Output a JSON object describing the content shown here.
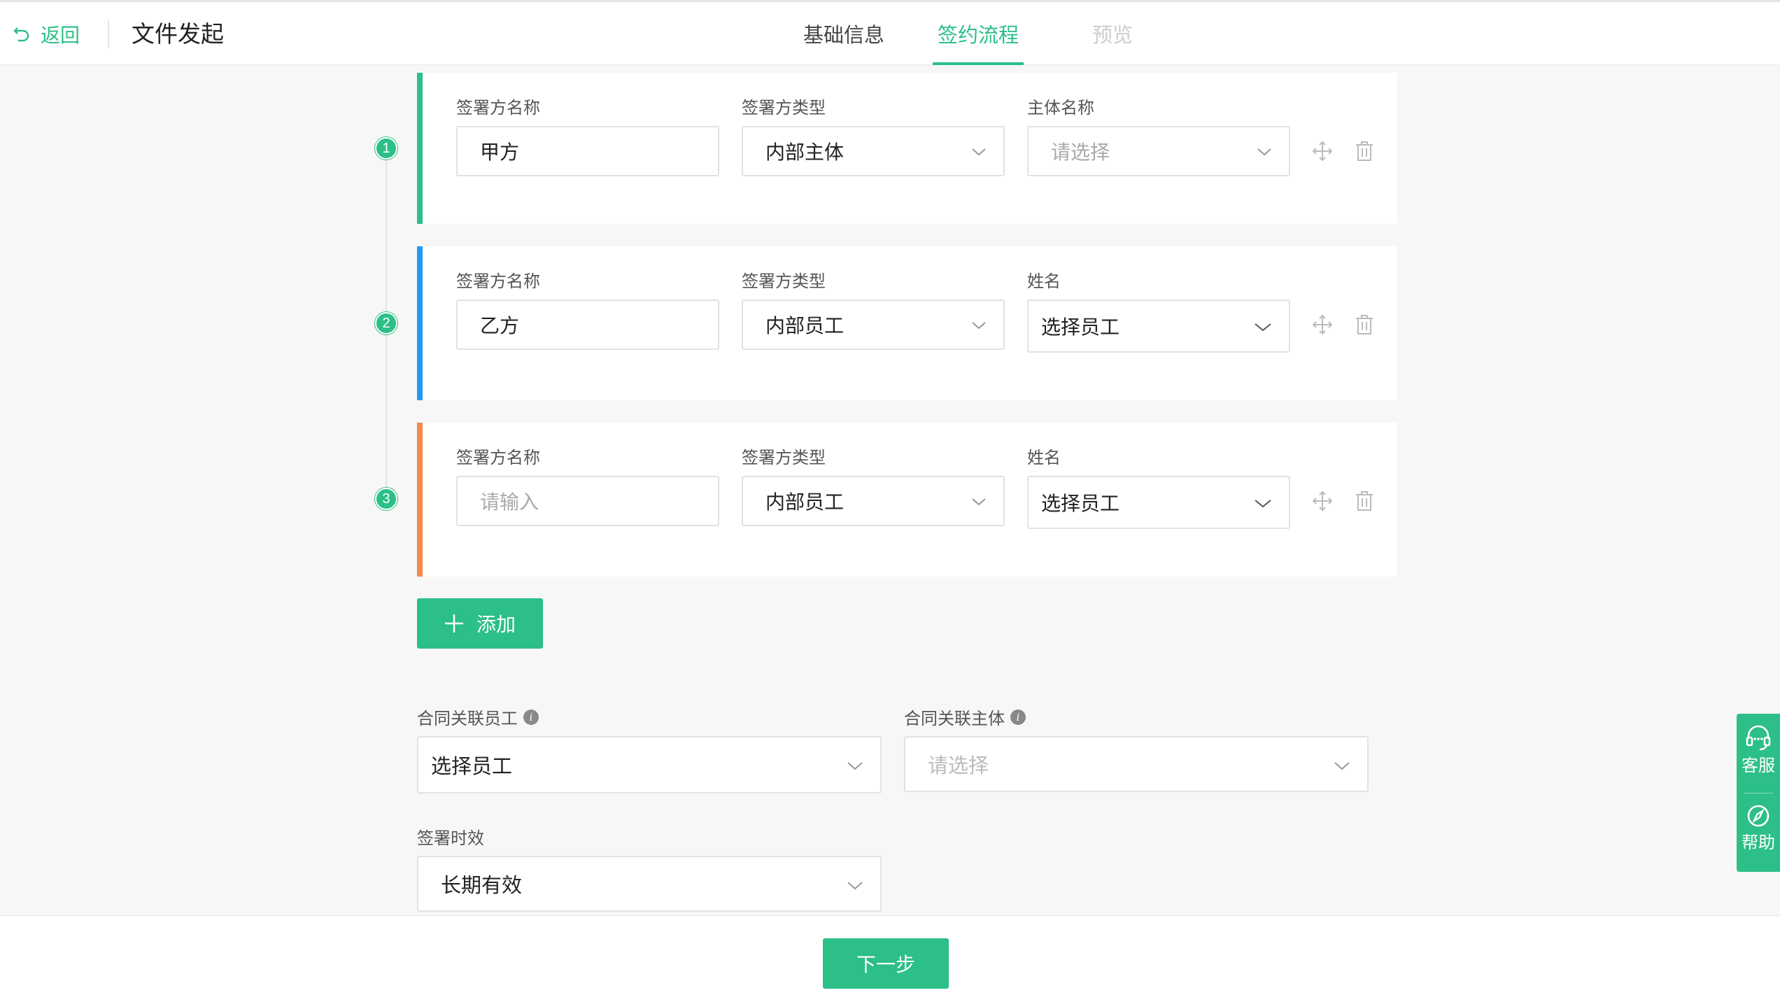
{
  "header": {
    "back_label": "返回",
    "title": "文件发起",
    "tabs": [
      {
        "label": "基础信息",
        "state": "normal"
      },
      {
        "label": "签约流程",
        "state": "active"
      },
      {
        "label": "预览",
        "state": "disabled"
      }
    ]
  },
  "colors": {
    "accent": "#2cbf87",
    "signer1_bar": "#2cbf87",
    "signer2_bar": "#1e9bf0",
    "signer3_bar": "#f5884a"
  },
  "signers": [
    {
      "step": "1",
      "name_label": "签署方名称",
      "name_value": "甲方",
      "type_label": "签署方类型",
      "type_value": "内部主体",
      "third_label": "主体名称",
      "third_value": "请选择"
    },
    {
      "step": "2",
      "name_label": "签署方名称",
      "name_value": "乙方",
      "type_label": "签署方类型",
      "type_value": "内部员工",
      "third_label": "姓名",
      "third_value": "选择员工"
    },
    {
      "step": "3",
      "name_label": "签署方名称",
      "name_placeholder": "请输入",
      "type_label": "签署方类型",
      "type_value": "内部员工",
      "third_label": "姓名",
      "third_value": "选择员工"
    }
  ],
  "add_button_label": "添加",
  "related": {
    "employee_label": "合同关联员工",
    "employee_value": "选择员工",
    "entity_label": "合同关联主体",
    "entity_placeholder": "请选择",
    "validity_label": "签署时效",
    "validity_value": "长期有效"
  },
  "footer": {
    "next_label": "下一步"
  },
  "float": {
    "service_label": "客服",
    "help_label": "帮助"
  },
  "icons": [
    "back-icon",
    "chevron-down-icon",
    "move-icon",
    "trash-icon",
    "plus-icon",
    "info-icon",
    "headset-icon",
    "compass-icon"
  ]
}
